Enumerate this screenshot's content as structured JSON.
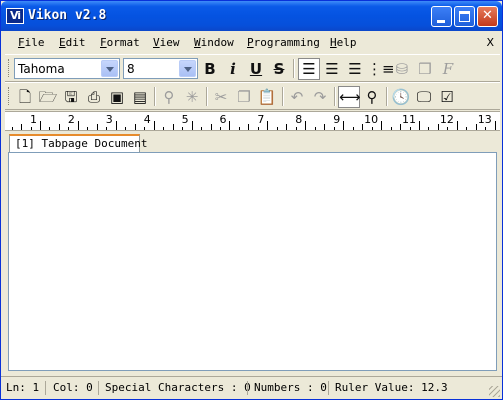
{
  "window": {
    "title": "Vikon v2.8",
    "icon_label": "Vi"
  },
  "menu": {
    "items": [
      {
        "label": "File",
        "accel": "F"
      },
      {
        "label": "Edit",
        "accel": "E"
      },
      {
        "label": "Format",
        "accel": "F"
      },
      {
        "label": "View",
        "accel": "V"
      },
      {
        "label": "Window",
        "accel": "W"
      },
      {
        "label": "Programming",
        "accel": "P"
      },
      {
        "label": "Help",
        "accel": "H"
      }
    ],
    "close_label": "X"
  },
  "format_toolbar": {
    "font": "Tahoma",
    "size": "8",
    "bold_label": "B",
    "italic_label": "i",
    "underline_label": "U",
    "strike_label": "S"
  },
  "ruler": {
    "labels": [
      "1",
      "2",
      "3",
      "4",
      "5",
      "6",
      "7",
      "8",
      "9",
      "10",
      "11",
      "12",
      "13"
    ]
  },
  "tabs": [
    {
      "label": "[1] Tabpage Document"
    }
  ],
  "status": {
    "line": "Ln: 1",
    "col": "Col: 0",
    "special": "Special Characters : 0",
    "numbers": "Numbers : 0",
    "ruler_value": "Ruler Value: 12.3"
  },
  "colors": {
    "titlebar": "#0553E1",
    "tab_accent": "#E68B2C",
    "window_bg": "#ECE9D8"
  }
}
